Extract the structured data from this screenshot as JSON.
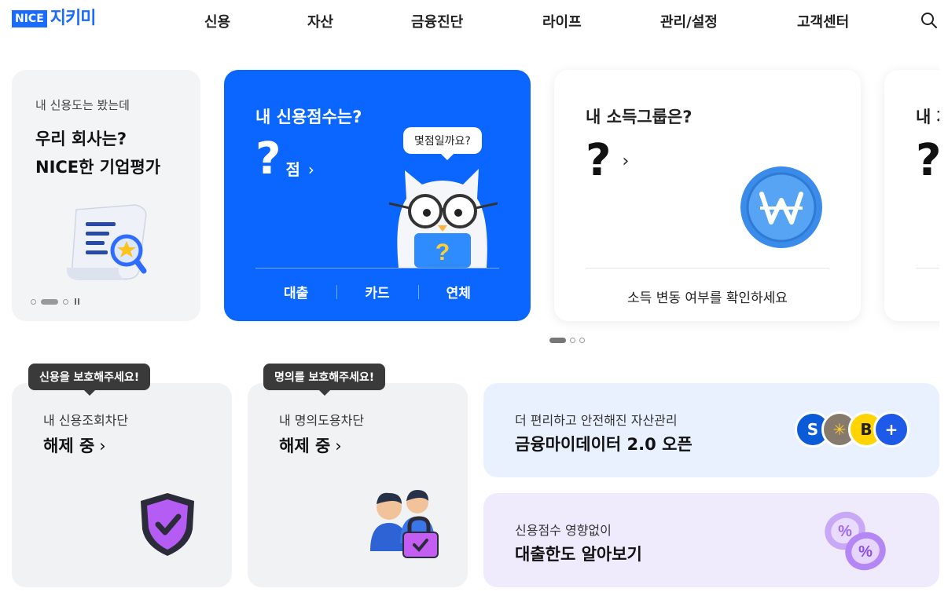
{
  "brand": {
    "nice": "NICE",
    "name": "지키미",
    "color": "#1a6bff"
  },
  "nav": {
    "items": [
      {
        "label": "신용"
      },
      {
        "label": "자산"
      },
      {
        "label": "금융진단"
      },
      {
        "label": "라이프"
      },
      {
        "label": "관리/설정"
      },
      {
        "label": "고객센터"
      }
    ],
    "search_icon": "search-icon"
  },
  "promo": {
    "subtitle": "내 신용도는 봤는데",
    "title": "우리 회사는?\nNICE한 기업평가",
    "icon": "report-magnifier-icon",
    "pager": {
      "total": 3,
      "active": 2
    }
  },
  "credit_card": {
    "title": "내 신용점수는?",
    "score": "?",
    "unit": "점",
    "bubble": "몇점일까요?",
    "tabs": [
      "대출",
      "카드",
      "연체"
    ],
    "color": "#0a66ff"
  },
  "income_card": {
    "title": "내 소득그룹은?",
    "value": "?",
    "note": "소득 변동 여부를 확인하세요",
    "icon": "won-coin-icon"
  },
  "peek_card": {
    "title": "내 차",
    "value": "?"
  },
  "carousel_pager": {
    "total": 3,
    "active": 1
  },
  "block_credit": {
    "tooltip": "신용을 보호해주세요!",
    "subtitle": "내 신용조회차단",
    "status": "해제 중",
    "icon": "shield-check-icon"
  },
  "block_identity": {
    "tooltip": "명의를 보호해주세요!",
    "subtitle": "내 명의도용차단",
    "status": "해제 중",
    "icon": "people-lock-icon"
  },
  "mydata": {
    "subtitle": "더 편리하고 안전해진 자산관리",
    "title": "금융마이데이터 2.0 오픈",
    "logos": [
      "S",
      "✳",
      "B",
      "+"
    ]
  },
  "loan": {
    "subtitle": "신용점수 영향없이",
    "title": "대출한도 알아보기",
    "icon": "percent-icon"
  }
}
